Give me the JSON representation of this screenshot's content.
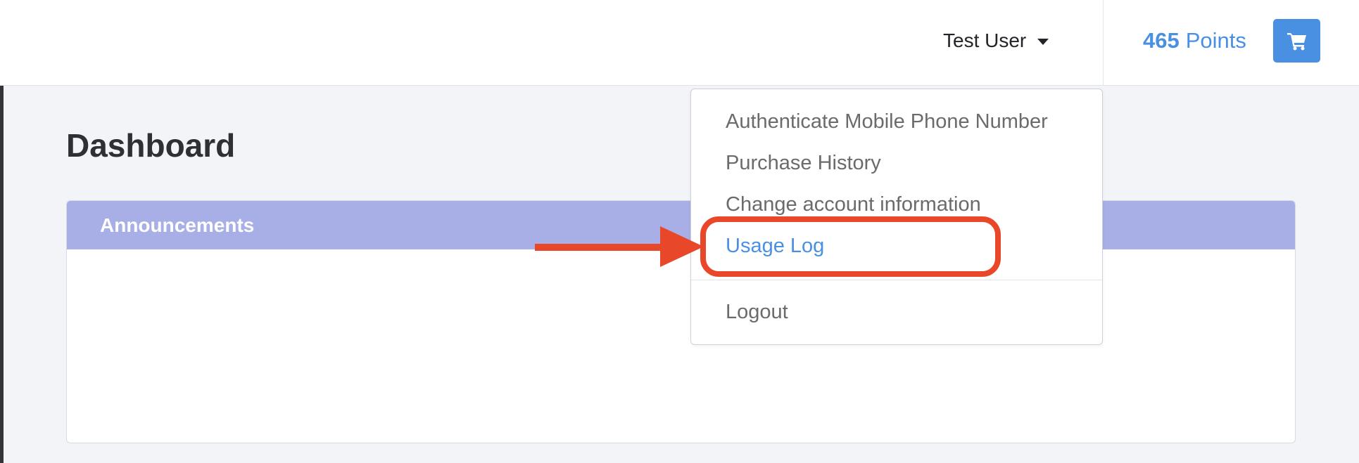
{
  "header": {
    "user_name": "Test User",
    "points_value": "465",
    "points_label": "Points",
    "cart_icon": "cart-icon"
  },
  "page": {
    "title": "Dashboard"
  },
  "announcements": {
    "title": "Announcements"
  },
  "user_dropdown": {
    "items": [
      {
        "label": "Authenticate Mobile Phone Number"
      },
      {
        "label": "Purchase History"
      },
      {
        "label": "Change account information"
      },
      {
        "label": "Usage Log"
      }
    ],
    "logout_label": "Logout",
    "active_item": "Usage Log"
  },
  "colors": {
    "accent": "#4a90e2",
    "announcement_header": "#a8afe7",
    "annotation": "#e8472a"
  }
}
